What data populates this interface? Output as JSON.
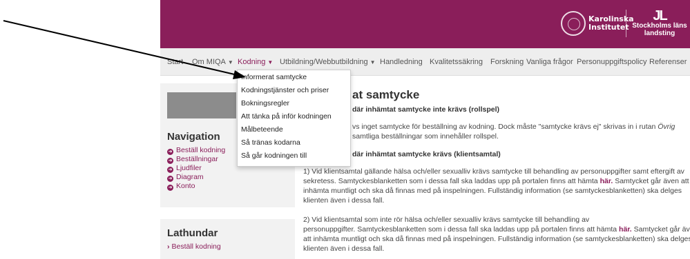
{
  "header": {
    "ki_logo_text_1": "Karolinska",
    "ki_logo_text_2": "Institutet",
    "sll_logo_mark": "JL",
    "sll_logo_text_1": "Stockholms läns",
    "sll_logo_text_2": "landsting"
  },
  "nav": {
    "items": [
      "Start",
      "Om MIQA",
      "Kodning",
      "Utbildning/Webbutbildning",
      "Handledning",
      "Kvalitetssäkring",
      "Forskning",
      "Vanliga frågor",
      "Personuppgiftspolicy",
      "Referenser"
    ]
  },
  "dropdown": {
    "items": [
      "Informerat samtycke",
      "Kodningstjänster och priser",
      "Bokningsregler",
      "Att tänka på inför kodningen",
      "Målbeteende",
      "Så tränas kodarna",
      "Så går kodningen till"
    ]
  },
  "sidebar": {
    "nav_title": "Navigation",
    "nav_links": [
      "Beställ kodning",
      "Beställningar",
      "Ljudfiler",
      "Diagram",
      "Konto"
    ],
    "lathundar_title": "Lathundar",
    "lathundar_links": [
      "Beställ kodning"
    ]
  },
  "main": {
    "title_visible": "at samtycke",
    "sub1_visible": "där inhämtat samtycke inte krävs (rollspel)",
    "p1_line1": "vs inget samtycke för beställning av kodning. Dock måste \"samtycke krävs ej\" skrivas in i rutan",
    "p1_italic": "Övrig",
    "p1_line2": "samtliga beställningar som innehåller rollspel.",
    "sub2_visible": "där inhämtat samtycke krävs (klientsamtal)",
    "p2_line1": "1) Vid klientsamtal gällande hälsa och/eller sexualliv krävs samtycke till behandling av personuppgifter samt eftergift av",
    "p2_line2_pre": "sekretess. Samtyckesblanketten som i dessa fall ska laddas upp på portalen finns att hämta",
    "p2_link": "här.",
    "p2_line2_post": "Samtycket går även att",
    "p2_line3": "inhämta muntligt och ska då finnas med på inspelningen. Fullständig information (se samtyckesblanketten) ska delges",
    "p2_line4": "klienten även i dessa fall.",
    "p3_line1": "2) Vid klientsamtal som inte rör hälsa och/eller sexualliv krävs samtycke till behandling av",
    "p3_line2_pre": "personuppgifter. Samtyckesblanketten som i dessa fall ska laddas upp på portalen finns att hämta",
    "p3_link": "här.",
    "p3_line2_post": "Samtycket går även",
    "p3_line3": "att inhämta muntligt och ska då finnas med på inspelningen. Fullständig information (se samtyckesblanketten) ska delges",
    "p3_line4": "klienten även i dessa fall."
  },
  "colors": {
    "brand": "#8a1e5a",
    "navbar_bg": "#eeeeee",
    "sidebar_bg": "#f2f2f2"
  },
  "icons": {
    "nav_link_icon": "circle-arrow-right-icon",
    "lathundar_link_icon": "chevron-right-icon"
  }
}
